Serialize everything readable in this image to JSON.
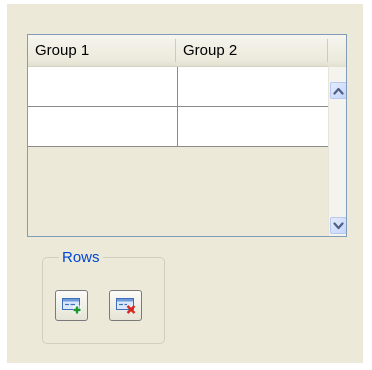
{
  "table": {
    "columns": [
      "Group 1",
      "Group 2"
    ],
    "rows": [
      [
        "",
        ""
      ],
      [
        "",
        ""
      ]
    ]
  },
  "rows_group": {
    "label": "Rows",
    "add_row_icon": "add-row-icon",
    "delete_row_icon": "delete-row-icon"
  },
  "scrollbar": {
    "up_icon": "chevron-up-icon",
    "down_icon": "chevron-down-icon"
  },
  "colors": {
    "panel_background": "#ece9d8",
    "grid_border": "#7f9db9",
    "group_label": "#0046d5",
    "scroll_arrow": "#4d6185"
  }
}
